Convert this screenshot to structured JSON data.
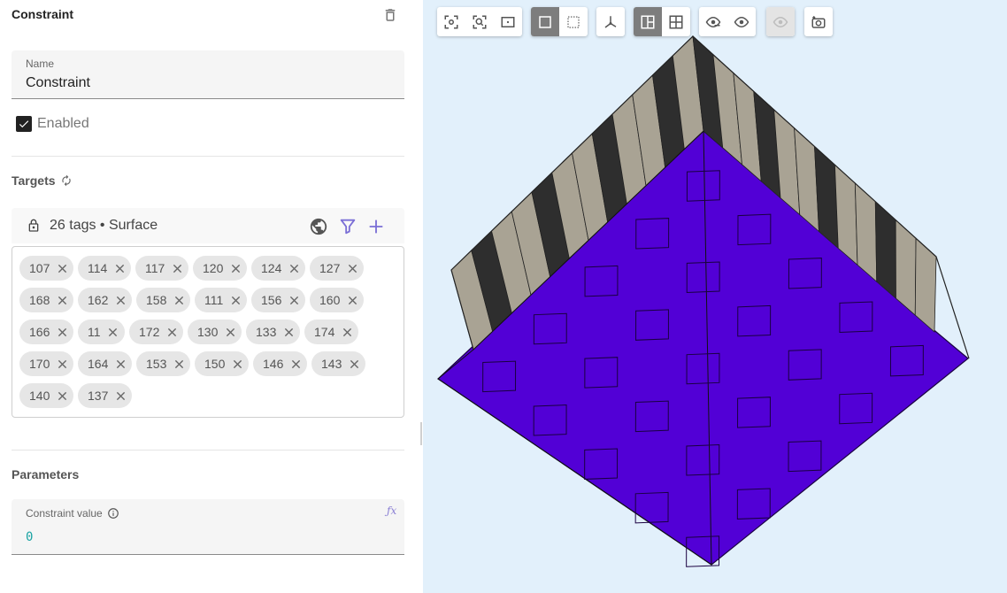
{
  "panel": {
    "title": "Constraint",
    "name_label": "Name",
    "name_value": "Constraint",
    "enabled_label": "Enabled",
    "enabled": true
  },
  "targets": {
    "title": "Targets",
    "summary": "26 tags • Surface",
    "tags": [
      "107",
      "114",
      "117",
      "120",
      "124",
      "127",
      "168",
      "162",
      "158",
      "111",
      "156",
      "160",
      "166",
      "11",
      "172",
      "130",
      "133",
      "174",
      "170",
      "164",
      "153",
      "150",
      "146",
      "143",
      "140",
      "137"
    ]
  },
  "parameters": {
    "title": "Parameters",
    "field_label": "Constraint value",
    "field_value": "0"
  },
  "toolbar": {
    "icons": [
      "zoom-to-fit-icon",
      "zoom-selection-icon",
      "zoom-box-icon",
      "solid-view-icon",
      "wireframe-view-icon",
      "axes-icon",
      "section-view-icon",
      "grid-view-icon",
      "show-hidden-icon",
      "visibility-icon",
      "hide-icon",
      "screenshot-icon"
    ]
  },
  "colors": {
    "accent": "#7b6fd6",
    "face_purple": "#5200d6",
    "stripe_light": "#a9a394",
    "stripe_dark": "#2e2e2e",
    "viewport_bg": "#e2f0fb"
  }
}
